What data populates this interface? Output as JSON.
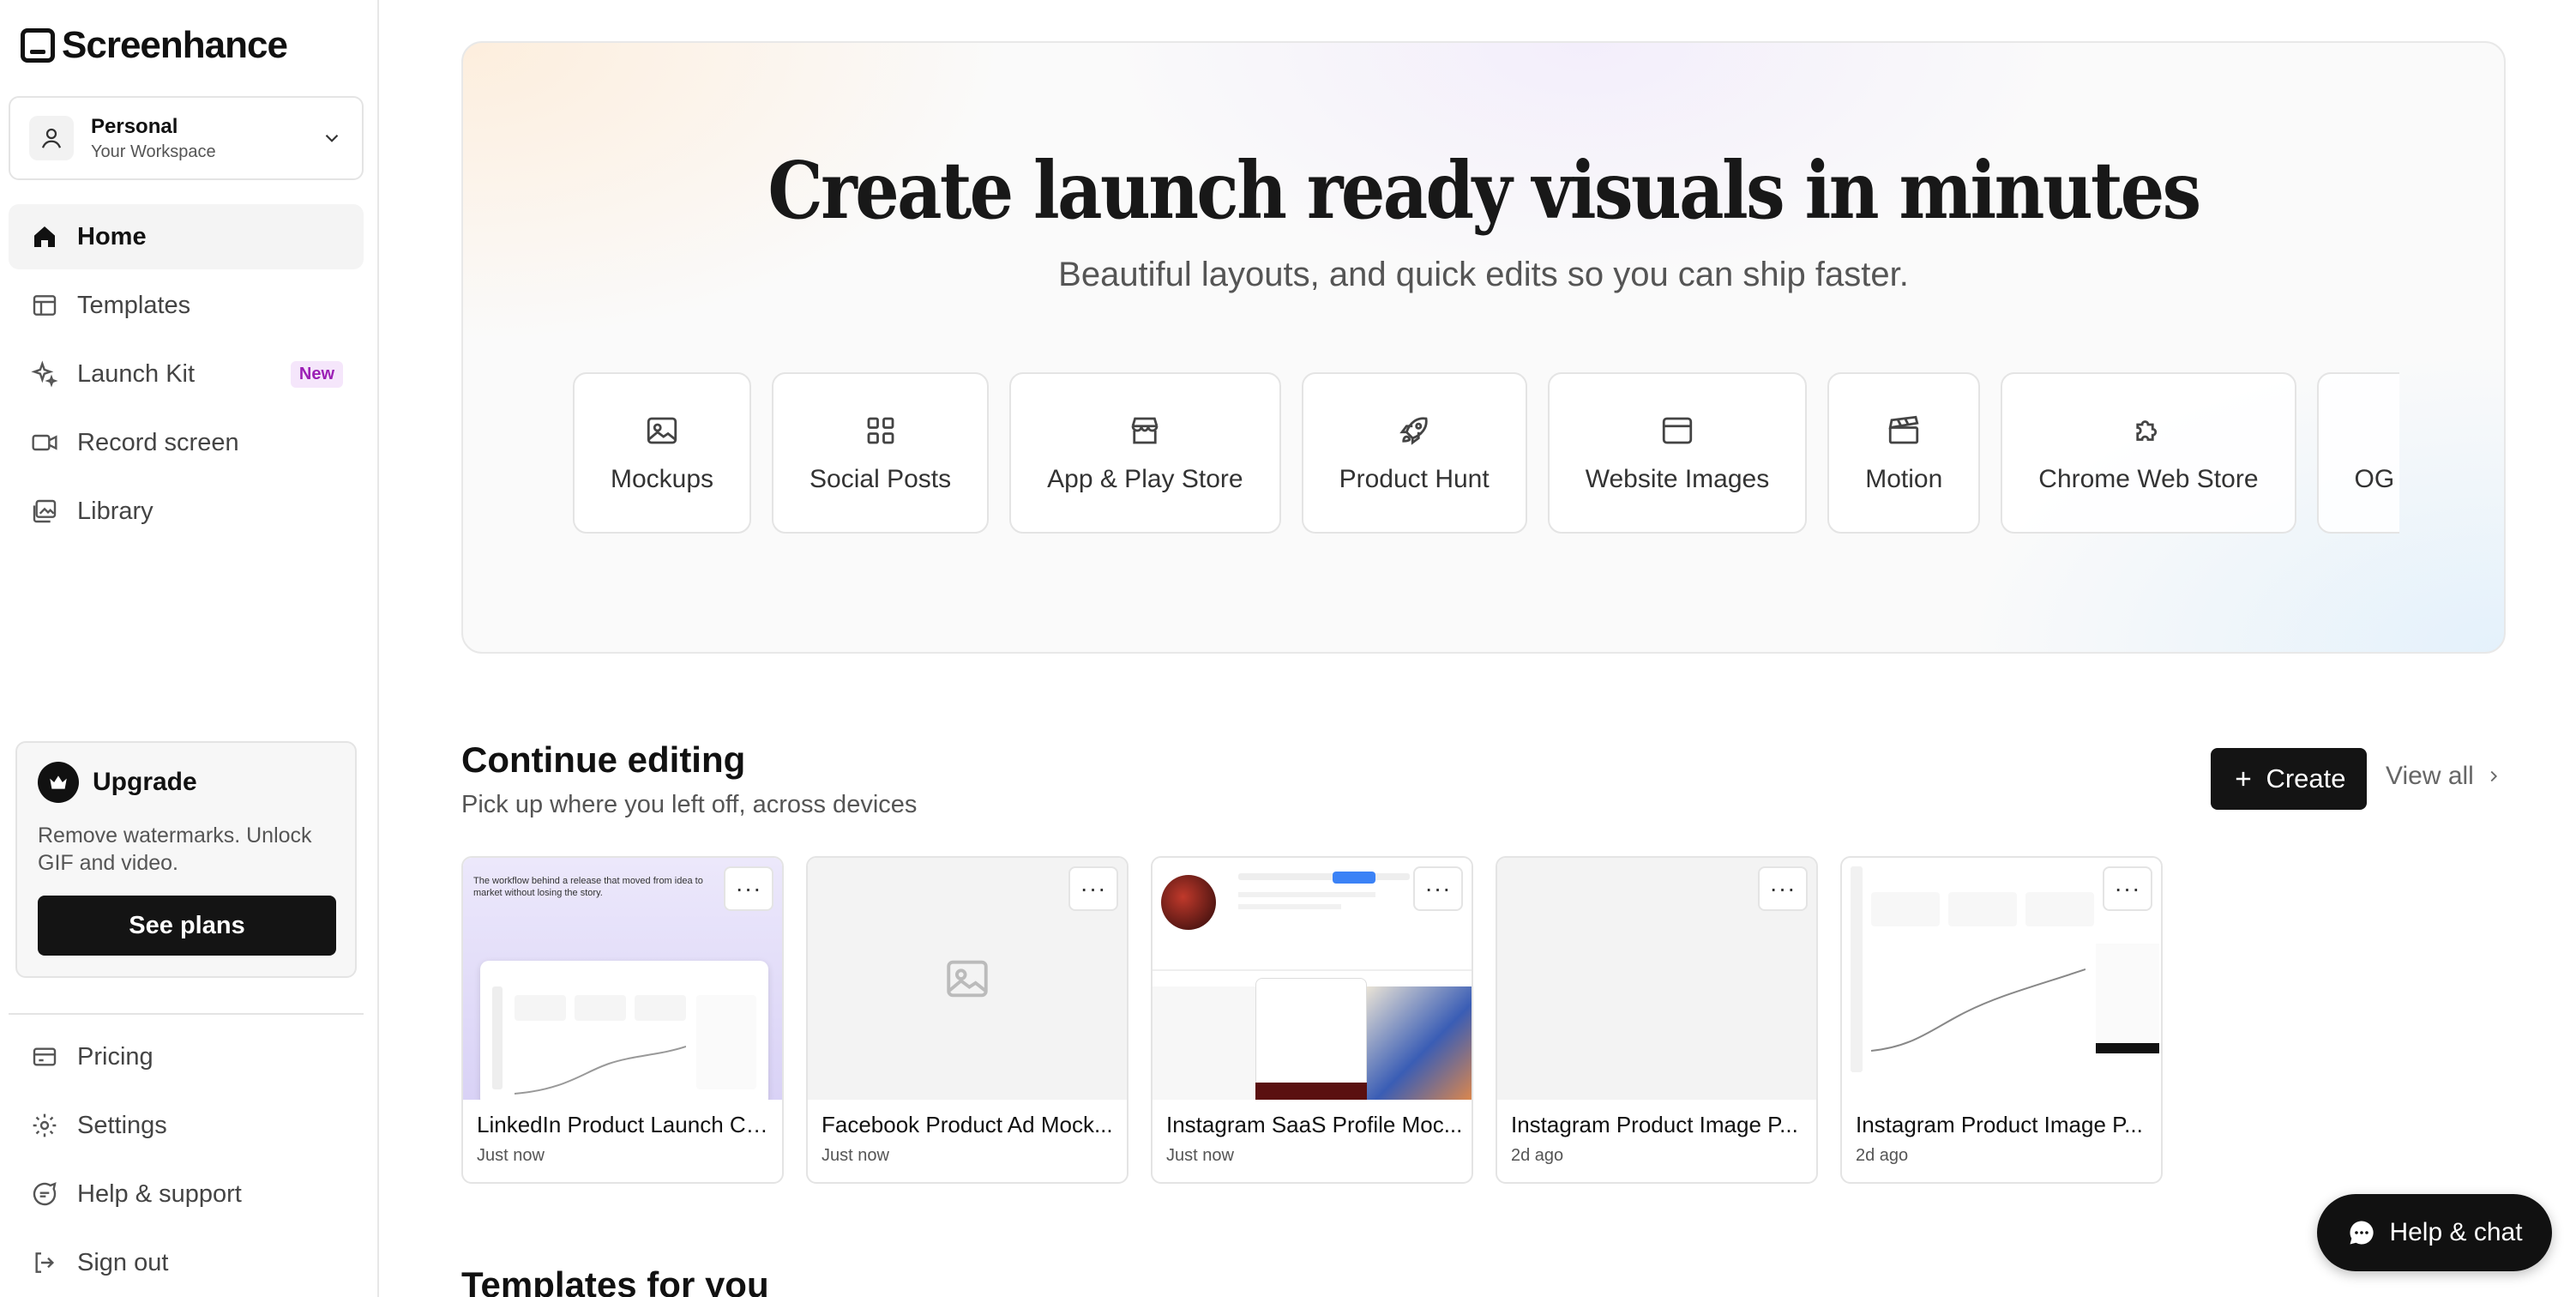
{
  "app": {
    "name": "Screenhance"
  },
  "workspace": {
    "name": "Personal",
    "subtitle": "Your Workspace"
  },
  "nav": [
    {
      "label": "Home",
      "icon": "home-icon",
      "active": true
    },
    {
      "label": "Templates",
      "icon": "templates-icon"
    },
    {
      "label": "Launch Kit",
      "icon": "sparkle-icon",
      "badge": "New"
    },
    {
      "label": "Record screen",
      "icon": "video-icon"
    },
    {
      "label": "Library",
      "icon": "library-icon"
    }
  ],
  "upgrade": {
    "title": "Upgrade",
    "description": "Remove watermarks. Unlock GIF and video.",
    "button": "See plans"
  },
  "bottom_nav": [
    {
      "label": "Pricing",
      "icon": "pricing-icon"
    },
    {
      "label": "Settings",
      "icon": "gear-icon"
    },
    {
      "label": "Help & support",
      "icon": "help-icon"
    },
    {
      "label": "Sign out",
      "icon": "sign-out-icon"
    }
  ],
  "hero": {
    "title": "Create launch ready visuals in minutes",
    "subtitle": "Beautiful layouts, and quick edits so you can ship faster.",
    "categories": [
      {
        "label": "Mockups",
        "icon": "image-icon"
      },
      {
        "label": "Social Posts",
        "icon": "grid-icon"
      },
      {
        "label": "App & Play Store",
        "icon": "store-icon"
      },
      {
        "label": "Product Hunt",
        "icon": "rocket-icon"
      },
      {
        "label": "Website Images",
        "icon": "browser-icon"
      },
      {
        "label": "Motion",
        "icon": "clapperboard-icon"
      },
      {
        "label": "Chrome Web Store",
        "icon": "puzzle-icon"
      },
      {
        "label": "OG",
        "icon": ""
      }
    ]
  },
  "continue_editing": {
    "title": "Continue editing",
    "subtitle": "Pick up where you left off, across devices",
    "create_label": "Create",
    "view_all_label": "View all",
    "items": [
      {
        "title": "LinkedIn Product Launch Ca...",
        "time": "Just now",
        "thumb_text": "The workflow behind a release that moved from idea to market without losing the story."
      },
      {
        "title": "Facebook Product Ad Mock...",
        "time": "Just now"
      },
      {
        "title": "Instagram SaaS Profile Moc...",
        "time": "Just now"
      },
      {
        "title": "Instagram Product Image P...",
        "time": "2d ago"
      },
      {
        "title": "Instagram Product Image P...",
        "time": "2d ago"
      }
    ]
  },
  "templates_for_you": {
    "title": "Templates for you"
  },
  "help_chat": {
    "label": "Help & chat"
  }
}
